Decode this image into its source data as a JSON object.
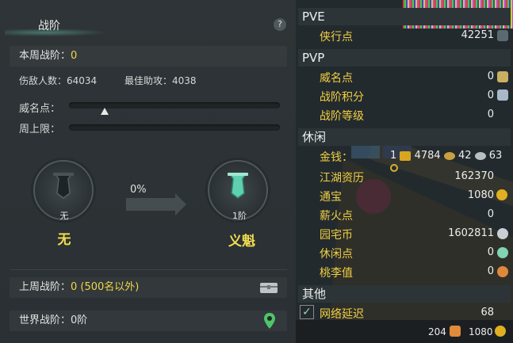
{
  "left_panel": {
    "title": "战阶",
    "help_label": "?",
    "week_rank": {
      "label": "本周战阶：",
      "value": "0"
    },
    "kills": {
      "label": "伤敌人数：",
      "value": "64034"
    },
    "best_assist": {
      "label": "最佳助攻：",
      "value": "4038"
    },
    "prestige_label": "威名点：",
    "prestige_progress": 0.17,
    "week_cap_label": "周上限：",
    "week_cap_progress": 0,
    "current_rank": {
      "badge": "无",
      "name": "无"
    },
    "progress_percent": "0%",
    "next_rank": {
      "badge": "1阶",
      "name": "义魁"
    },
    "last_week": {
      "label": "上周战阶：",
      "value": "0 (500名以外)"
    },
    "world_rank": {
      "label": "世界战阶：",
      "value": "0阶"
    }
  },
  "right_panel": {
    "sections": {
      "pve": "PVE",
      "pvp": "PVP",
      "leisure": "休闲",
      "other": "其他"
    },
    "pve_items": [
      {
        "label": "侠行点",
        "value": "42251"
      }
    ],
    "pvp_items": [
      {
        "label": "威名点",
        "value": "0"
      },
      {
        "label": "战阶积分",
        "value": "0"
      },
      {
        "label": "战阶等级",
        "value": "0"
      }
    ],
    "money": {
      "label": "金钱：",
      "gold": "1",
      "silver": "4784",
      "copper1": "42",
      "copper2": "63"
    },
    "leisure_items": [
      {
        "label": "江湖资历",
        "value": "162370"
      },
      {
        "label": "通宝",
        "value": "1080"
      },
      {
        "label": "薪火点",
        "value": "0"
      },
      {
        "label": "园宅币",
        "value": "1602811"
      },
      {
        "label": "休闲点",
        "value": "0"
      },
      {
        "label": "桃李值",
        "value": "0"
      }
    ],
    "latency": {
      "label": "网络延迟",
      "value": "68",
      "checked": true
    },
    "bottom": {
      "left_value": "204",
      "right_value": "1080"
    }
  },
  "colors": {
    "accent_yellow": "#f0d64a",
    "teal": "#5fd0b0"
  }
}
